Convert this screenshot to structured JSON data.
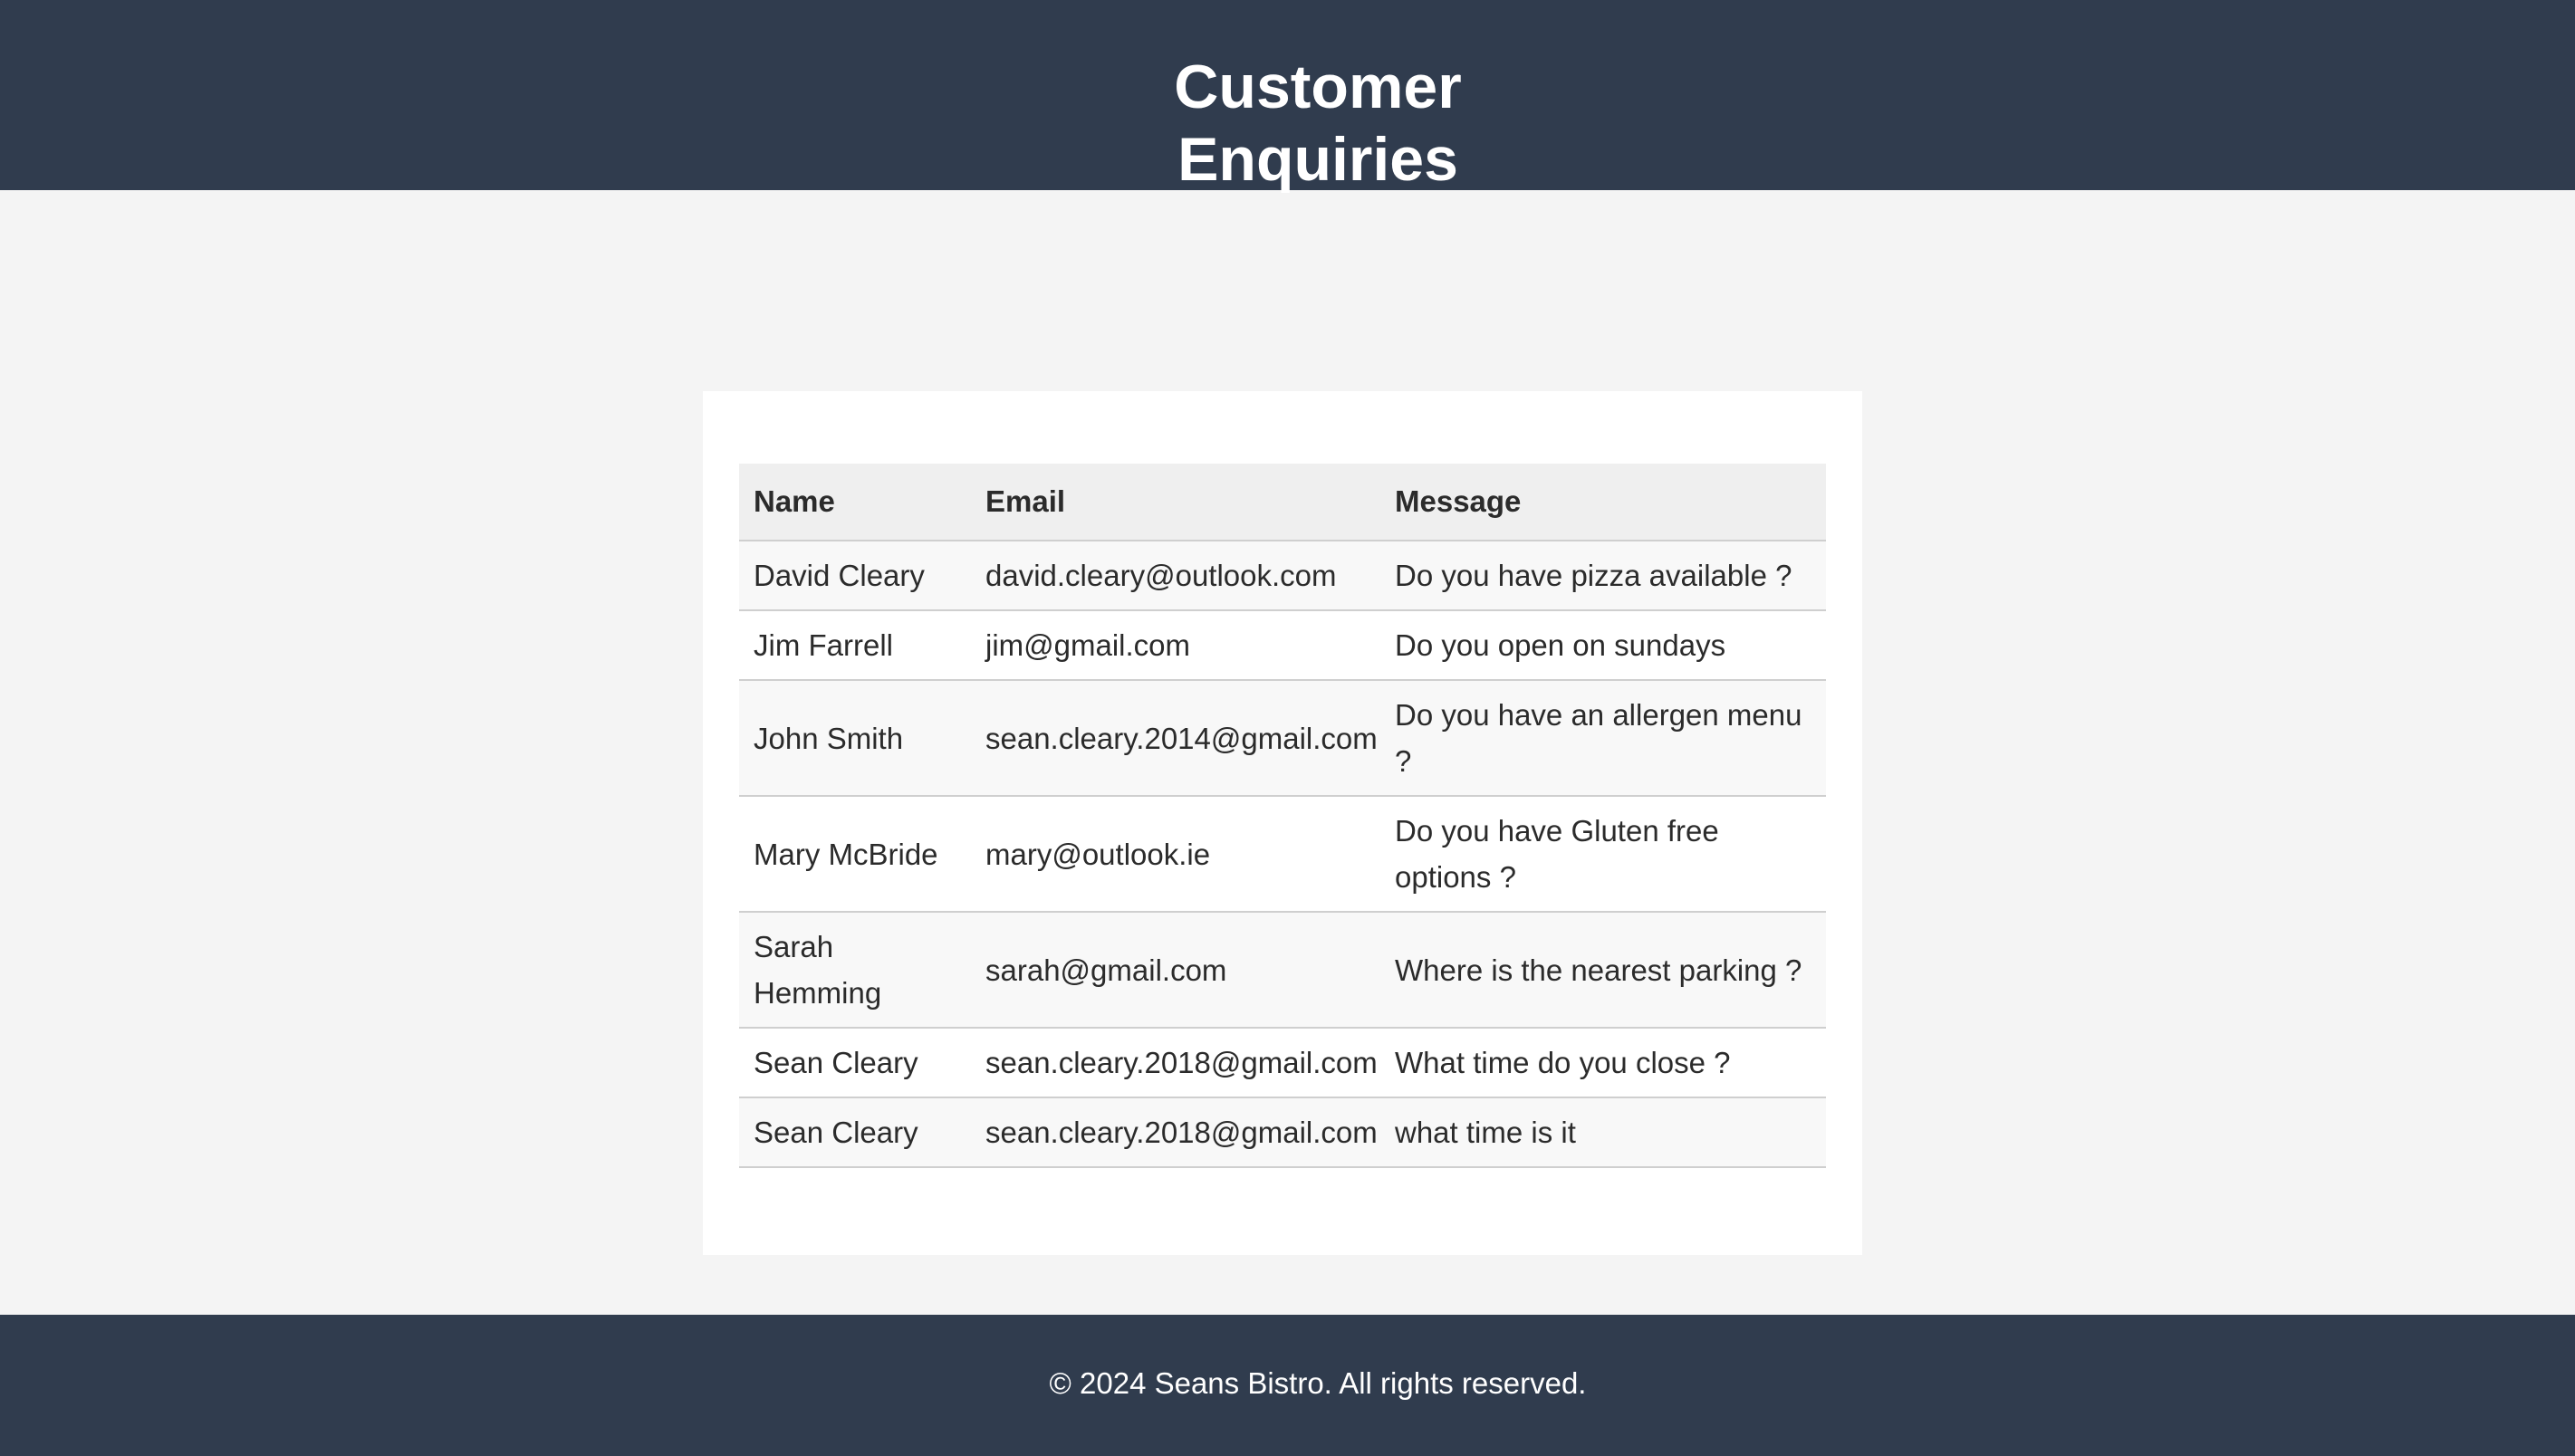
{
  "header": {
    "title": "Customer Enquiries"
  },
  "table": {
    "columns": [
      "Name",
      "Email",
      "Message"
    ],
    "rows": [
      {
        "name": "David Cleary",
        "email": "david.cleary@outlook.com",
        "message": "Do you have pizza available ?"
      },
      {
        "name": "Jim Farrell",
        "email": "jim@gmail.com",
        "message": "Do you open on sundays"
      },
      {
        "name": "John Smith",
        "email": "sean.cleary.2014@gmail.com",
        "message": "Do you have an allergen menu ?"
      },
      {
        "name": "Mary McBride",
        "email": "mary@outlook.ie",
        "message": "Do you have Gluten free options ?"
      },
      {
        "name": "Sarah Hemming",
        "email": "sarah@gmail.com",
        "message": "Where is the nearest parking ?"
      },
      {
        "name": "Sean Cleary",
        "email": "sean.cleary.2018@gmail.com",
        "message": "What time do you close ?"
      },
      {
        "name": "Sean Cleary",
        "email": "sean.cleary.2018@gmail.com",
        "message": "what time is it"
      }
    ]
  },
  "footer": {
    "copyright": "© 2024 Seans Bistro. All rights reserved."
  },
  "colors": {
    "header_bg": "#303c4e",
    "page_bg": "#f4f4f4",
    "table_header_bg": "#efefef"
  }
}
